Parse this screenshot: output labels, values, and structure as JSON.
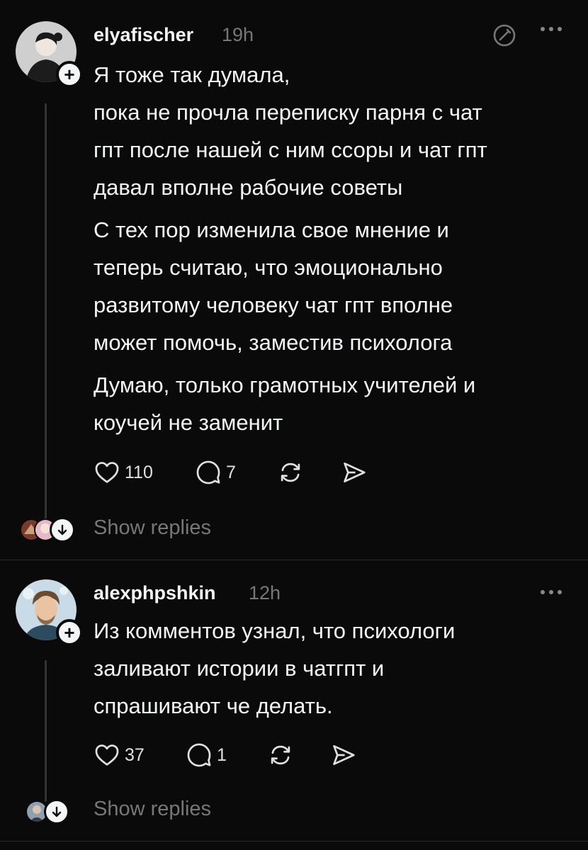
{
  "posts": [
    {
      "username": "elyafischer",
      "time": "19h",
      "paragraphs": [
        "Я тоже так думала,\nпока не прочла переписку парня с чат\nгпт после нашей с ним ссоры и чат гпт\nдавал вполне рабочие советы",
        "С тех пор изменила свое мнение и\nтеперь считаю, что эмоционально\nразвитому человеку чат гпт вполне\nможет помочь, заместив психолога",
        "Думаю, только грамотных учителей и\nкоучей не заменит"
      ],
      "likes": "110",
      "comments": "7",
      "show_replies": "Show replies"
    },
    {
      "username": "alexphpshkin",
      "time": "12h",
      "paragraphs": [
        "Из комментов узнал, что психологи\nзаливают истории в чатгпт и\nспрашивают че делать."
      ],
      "likes": "37",
      "comments": "1",
      "show_replies": "Show replies"
    }
  ],
  "icons": {
    "follow": "plus-icon",
    "like": "heart-icon",
    "comment": "comment-bubble-icon",
    "repost": "repost-icon",
    "share": "send-icon",
    "more": "more-dots-icon",
    "edit": "edit-circle-icon",
    "expand": "arrow-down-icon"
  },
  "colors": {
    "background": "#0a0a0a",
    "text": "#f3f5f7",
    "muted": "#777777"
  }
}
